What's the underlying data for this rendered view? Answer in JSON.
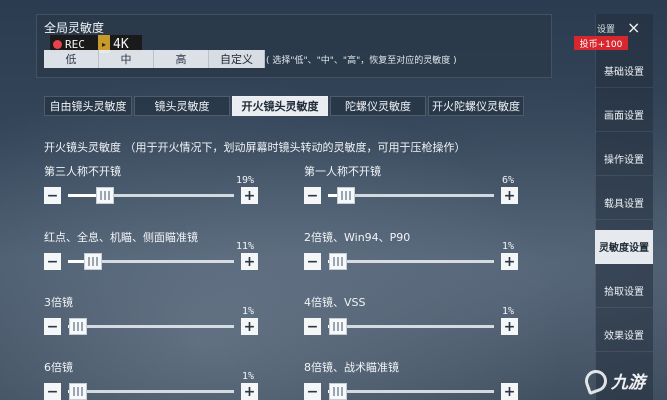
{
  "top": {
    "title": "全局灵敏度",
    "rec_label": "REC",
    "k_label": "4K",
    "presets": [
      {
        "label": "低",
        "active": false
      },
      {
        "label": "中",
        "active": false
      },
      {
        "label": "高",
        "active": false
      },
      {
        "label": "自定义",
        "active": true
      }
    ],
    "preset_note": "( 选择\"低\"、\"中\"、\"高\"，恢复至对应的灵敏度 )"
  },
  "tabs": [
    {
      "label": "自由镜头灵敏度",
      "active": false
    },
    {
      "label": "镜头灵敏度",
      "active": false
    },
    {
      "label": "开火镜头灵敏度",
      "active": true
    },
    {
      "label": "陀螺仪灵敏度",
      "active": false
    },
    {
      "label": "开火陀螺仪灵敏度",
      "active": false
    }
  ],
  "section": {
    "description": "开火镜头灵敏度 （用于开火情况下，划动屏幕时镜头转动的灵敏度，可用于压枪操作）"
  },
  "sliders": [
    {
      "label": "第三人称不开镜",
      "value": "19%",
      "fraction": 0.19
    },
    {
      "label": "第一人称不开镜",
      "value": "6%",
      "fraction": 0.06
    },
    {
      "label": "红点、全息、机瞄、侧面瞄准镜",
      "value": "11%",
      "fraction": 0.11
    },
    {
      "label": "2倍镜、Win94、P90",
      "value": "1%",
      "fraction": 0.01
    },
    {
      "label": "3倍镜",
      "value": "1%",
      "fraction": 0.01
    },
    {
      "label": "4倍镜、VSS",
      "value": "1%",
      "fraction": 0.01
    },
    {
      "label": "6倍镜",
      "value": "1%",
      "fraction": 0.01
    },
    {
      "label": "8倍镜、战术瞄准镜",
      "value": "",
      "fraction": 0.01
    }
  ],
  "sidebar": {
    "header": "设置",
    "close_symbol": "×",
    "coin_badge": "投币+100",
    "items": [
      {
        "label": "基础设置",
        "active": false
      },
      {
        "label": "画面设置",
        "active": false
      },
      {
        "label": "操作设置",
        "active": false
      },
      {
        "label": "载具设置",
        "active": false
      },
      {
        "label": "灵敏度设置",
        "active": true
      },
      {
        "label": "拾取设置",
        "active": false
      },
      {
        "label": "效果设置",
        "active": false
      }
    ]
  },
  "watermark": {
    "text": "九游"
  },
  "icons": {
    "minus": "minus-icon",
    "plus": "plus-icon",
    "close": "close-icon",
    "logo": "jiuyou-logo-icon"
  }
}
